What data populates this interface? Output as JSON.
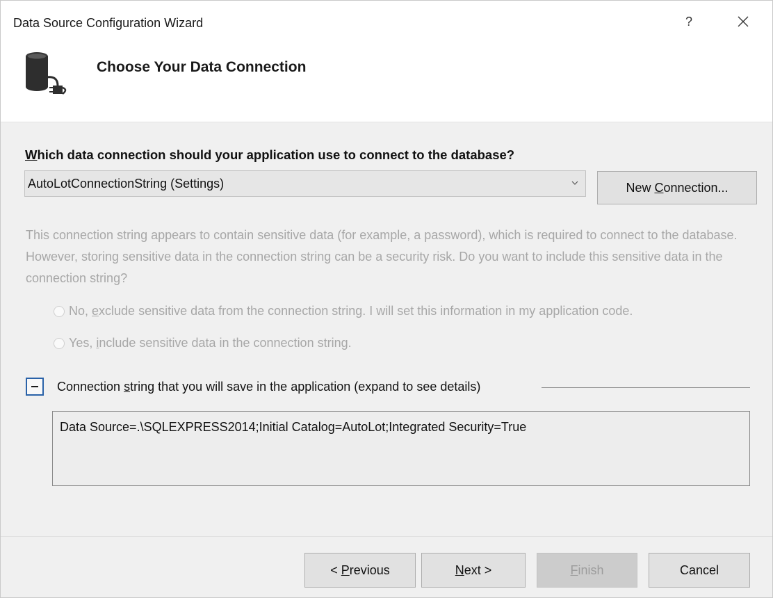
{
  "window": {
    "title": "Data Source Configuration Wizard",
    "help_label": "?"
  },
  "header": {
    "icon": "database-connection-icon",
    "title": "Choose Your Data Connection"
  },
  "question": {
    "accel": "W",
    "rest": "hich data connection should your application use to connect to the database?"
  },
  "connection_combo": {
    "value": "AutoLotConnectionString (Settings)",
    "icon": "chevron-down-icon"
  },
  "new_connection_button": {
    "pre": "New ",
    "accel": "C",
    "post": "onnection..."
  },
  "sensitive_notice": "This connection string appears to contain sensitive data (for example, a password), which is required to connect to the database. However, storing sensitive data in the connection string can be a security risk. Do you want to include this sensitive data in the connection string?",
  "options": [
    {
      "pre": "No, ",
      "accel": "e",
      "post": "xclude sensitive data from the connection string. I will set this information in my application code.",
      "selected": false,
      "enabled": false
    },
    {
      "pre": "Yes, ",
      "accel": "i",
      "post": "nclude sensitive data in the connection string.",
      "selected": false,
      "enabled": false
    }
  ],
  "connection_string_section": {
    "expander_icon": "collapse-minus-icon",
    "pre": "Connection ",
    "accel": "s",
    "post": "tring that you will save in the application (expand to see details)",
    "value": "Data Source=.\\SQLEXPRESS2014;Initial Catalog=AutoLot;Integrated Security=True"
  },
  "buttons": {
    "previous": {
      "pre": "< ",
      "accel": "P",
      "post": "revious"
    },
    "next": {
      "pre": "",
      "accel": "N",
      "post": "ext >"
    },
    "finish": {
      "pre": "",
      "accel": "F",
      "post": "inish",
      "enabled": false
    },
    "cancel": {
      "label": "Cancel"
    }
  },
  "colors": {
    "window_bg": "#f0f0f0",
    "header_bg": "#ffffff",
    "disabled_text": "#a7a7a7",
    "expander_border": "#2a62a8"
  }
}
